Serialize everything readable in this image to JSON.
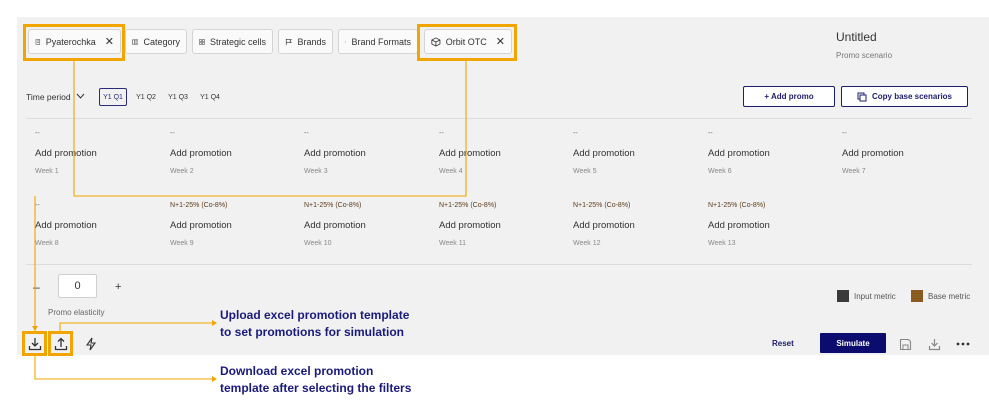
{
  "filters": [
    {
      "label": "Pyaterochka",
      "icon": "store-icon",
      "closable": true
    },
    {
      "label": "Category",
      "icon": "category-icon",
      "closable": false
    },
    {
      "label": "Strategic cells",
      "icon": "grid-icon",
      "closable": false
    },
    {
      "label": "Brands",
      "icon": "flag-icon",
      "closable": false
    },
    {
      "label": "Brand Formats",
      "icon": "box-icon",
      "closable": false
    },
    {
      "label": "Orbit OTC",
      "icon": "box-icon",
      "closable": true
    }
  ],
  "header": {
    "title": "Untitled",
    "subtitle": "Promo scenario"
  },
  "time_period": {
    "label": "Time period",
    "quarters": [
      "Y1 Q1",
      "Y1 Q2",
      "Y1 Q3",
      "Y1 Q4"
    ],
    "active": "Y1 Q1"
  },
  "actions": {
    "add_promo": "+ Add promo",
    "copy_base": "Copy base scenarios"
  },
  "weeks": [
    {
      "note": "--",
      "action": "Add promotion",
      "label": "Week 1"
    },
    {
      "note": "--",
      "action": "Add promotion",
      "label": "Week 2"
    },
    {
      "note": "--",
      "action": "Add promotion",
      "label": "Week 3"
    },
    {
      "note": "--",
      "action": "Add promotion",
      "label": "Week 4"
    },
    {
      "note": "--",
      "action": "Add promotion",
      "label": "Week 5"
    },
    {
      "note": "--",
      "action": "Add promotion",
      "label": "Week 6"
    },
    {
      "note": "--",
      "action": "Add promotion",
      "label": "Week 7"
    },
    {
      "note": "--",
      "action": "Add promotion",
      "label": "Week 8"
    },
    {
      "note": "N+1-25% (Co-8%)",
      "action": "Add promotion",
      "label": "Week 9"
    },
    {
      "note": "N+1-25% (Co-8%)",
      "action": "Add promotion",
      "label": "Week 10"
    },
    {
      "note": "N+1-25% (Co-8%)",
      "action": "Add promotion",
      "label": "Week 11"
    },
    {
      "note": "N+1-25% (Co-8%)",
      "action": "Add promotion",
      "label": "Week 12"
    },
    {
      "note": "N+1-25% (Co-8%)",
      "action": "Add promotion",
      "label": "Week 13"
    }
  ],
  "elasticity": {
    "minus": "–",
    "value": "0",
    "plus": "+",
    "label": "Promo elasticity"
  },
  "legend": [
    {
      "label": "Input metric",
      "color": "#3a3a3a"
    },
    {
      "label": "Base metric",
      "color": "#8b5a1e"
    }
  ],
  "footer": {
    "reset": "Reset",
    "simulate": "Simulate"
  },
  "callouts": {
    "upload": [
      "Upload excel promotion template",
      "to set promotions for simulation"
    ],
    "download": [
      "Download excel promotion",
      "template after selecting the filters"
    ]
  },
  "colors": {
    "accent": "#0c0c6e",
    "highlight": "#f0a500",
    "callout_text": "#1a1a7a"
  }
}
